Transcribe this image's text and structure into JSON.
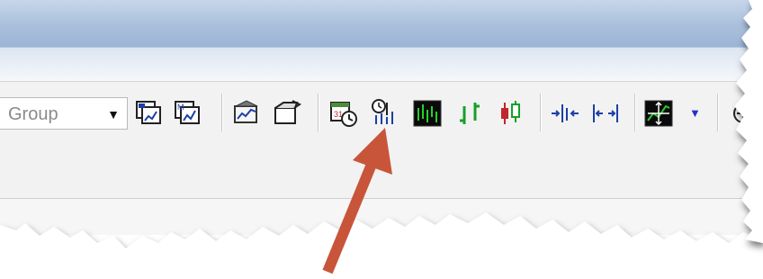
{
  "toolbar": {
    "group_combo": {
      "value": "Group"
    },
    "buttons": [
      {
        "icon": "chart-group-icon-1"
      },
      {
        "icon": "chart-group-icon-2"
      },
      {
        "icon": "chart-template-icon"
      },
      {
        "icon": "chart-open-icon"
      },
      {
        "icon": "calendar-clock-icon"
      },
      {
        "icon": "tick-bars-icon"
      },
      {
        "icon": "green-bar-chart-icon"
      },
      {
        "icon": "ohlc-bars-icon"
      },
      {
        "icon": "candlestick-icon"
      },
      {
        "icon": "zoom-in-bars-icon"
      },
      {
        "icon": "zoom-out-bars-icon"
      },
      {
        "icon": "auto-scale-icon"
      },
      {
        "icon": "dropdown-chevron-icon"
      },
      {
        "icon": "crosshair-icon"
      }
    ]
  },
  "annotation": {
    "arrow_color": "#c8553a"
  }
}
